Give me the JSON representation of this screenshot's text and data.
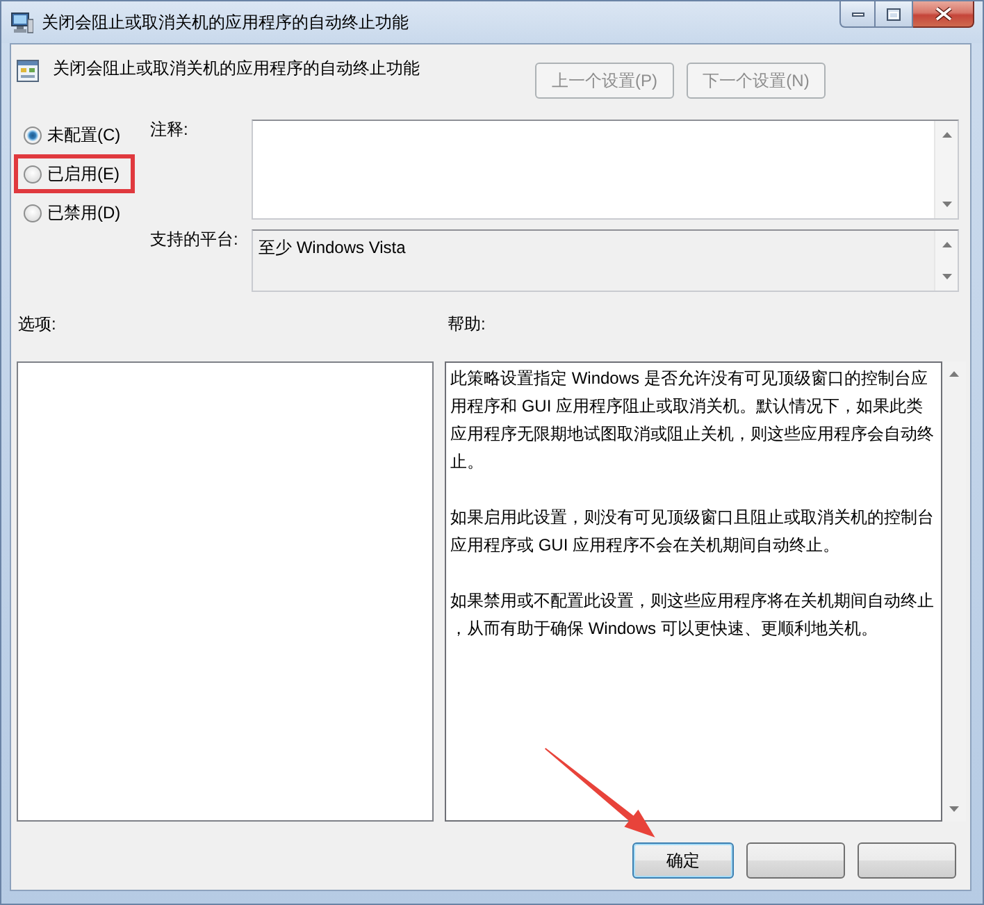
{
  "window": {
    "title": "关闭会阻止或取消关机的应用程序的自动终止功能"
  },
  "header": {
    "title": "关闭会阻止或取消关机的应用程序的自动终止功能",
    "nav_buttons": [
      {
        "label": "上一个设置(P)",
        "disabled": true
      },
      {
        "label": "下一个设置(N)",
        "disabled": true
      }
    ]
  },
  "state_options": [
    {
      "label": "未配置(C)",
      "selected": true,
      "highlighted": false
    },
    {
      "label": "已启用(E)",
      "selected": false,
      "highlighted": true
    },
    {
      "label": "已禁用(D)",
      "selected": false,
      "highlighted": false
    }
  ],
  "comment": {
    "label": "注释:"
  },
  "platform": {
    "label": "支持的平台:",
    "value": "至少 Windows Vista"
  },
  "options": {
    "label": "选项:"
  },
  "help": {
    "label": "帮助:",
    "paragraphs": [
      "此策略设置指定 Windows 是否允许没有可见顶级窗口的控制台应用程序和 GUI 应用程序阻止或取消关机。默认情况下，如果此类应用程序无限期地试图取消或阻止关机，则这些应用程序会自动终止。",
      "如果启用此设置，则没有可见顶级窗口且阻止或取消关机的控制台应用程序或 GUI 应用程序不会在关机期间自动终止。",
      "如果禁用或不配置此设置，则这些应用程序将在关机期间自动终止，从而有助于确保 Windows 可以更快速、更顺利地关机。"
    ]
  },
  "footer_buttons": [
    {
      "label": "确定",
      "focused": true,
      "arrow_pointing": true
    },
    {
      "focused": false,
      "arrow_pointing": false
    },
    {
      "focused": false,
      "arrow_pointing": false
    }
  ]
}
